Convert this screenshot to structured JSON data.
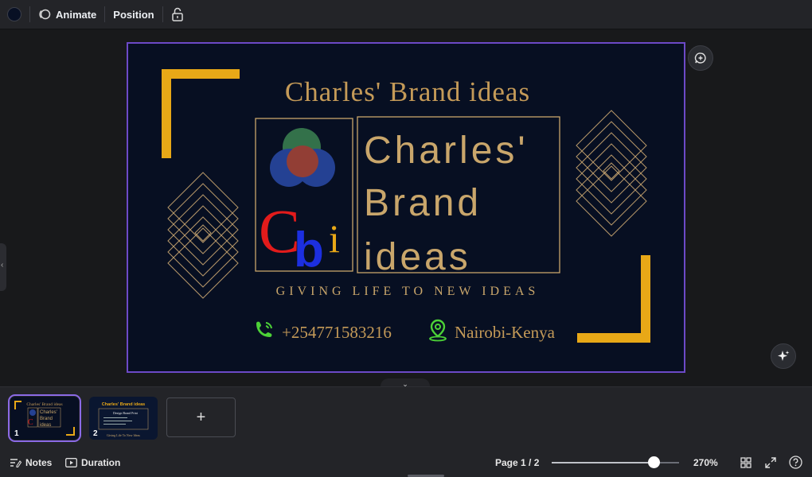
{
  "toolbar": {
    "color_swatch": "#081024",
    "animate_label": "Animate",
    "position_label": "Position",
    "lock_icon": "unlock-icon"
  },
  "slide": {
    "top_title": "Charles' Brand ideas",
    "big_title": [
      "Charles'",
      "Brand",
      "ideas"
    ],
    "logo_text": [
      "C",
      "b",
      "i"
    ],
    "tagline": "GIVING LIFE TO NEW IDEAS",
    "phone": "+254771583216",
    "location": "Nairobi-Kenya",
    "colors": {
      "background": "#070f22",
      "gold": "#c9a66b",
      "accent_yellow": "#e8a817",
      "contact": "#c49a58"
    }
  },
  "thumbnails": [
    {
      "number": "1",
      "title": "Charles' Brand ideas",
      "lines": [
        "Charles'",
        "Brand",
        "ideas"
      ]
    },
    {
      "number": "2",
      "title": "Charles' Brand ideas",
      "subtitle": "Design Brand Print",
      "footer": "Giving Life To New Ideas"
    }
  ],
  "add_page_label": "+",
  "status_bar": {
    "notes_label": "Notes",
    "duration_label": "Duration",
    "page_indicator": "Page 1 / 2",
    "zoom_label": "270%",
    "zoom_fraction": 0.8
  }
}
